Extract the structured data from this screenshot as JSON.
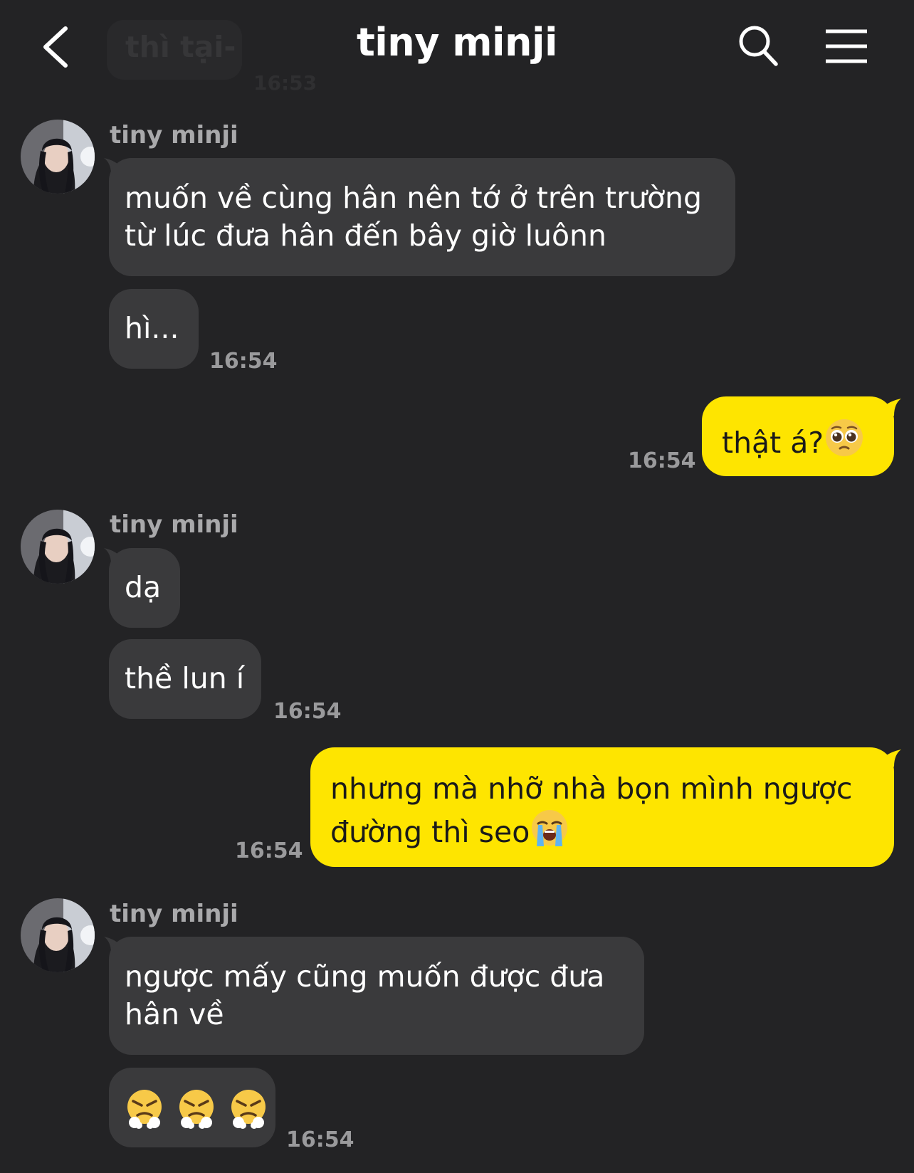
{
  "header": {
    "title": "tiny minji",
    "ghost_text": "thì tại-",
    "ghost_time": "16:53"
  },
  "messages": [
    {
      "sender": "tiny minji",
      "lines": [
        "muốn về cùng hân nên tớ ở trên trường",
        "từ lúc đưa hân đến bây giờ luônn"
      ]
    },
    {
      "text": "hì...",
      "time": "16:54"
    },
    {
      "text": "thật á?",
      "emoji": "pleading-face",
      "time": "16:54",
      "outgoing": true
    },
    {
      "sender": "tiny minji",
      "text": "dạ"
    },
    {
      "text": "thề lun í",
      "time": "16:54"
    },
    {
      "lines": [
        "nhưng mà nhỡ nhà bọn mình ngược",
        "đường thì seo"
      ],
      "emoji": "crying-face",
      "time": "16:54",
      "outgoing": true
    },
    {
      "sender": "tiny minji",
      "lines": [
        "ngược mấy cũng muốn được đưa",
        "hân về"
      ]
    },
    {
      "emoji": "huffing-face x3",
      "time": "16:54"
    }
  ],
  "colors": {
    "background": "#232325",
    "incoming_bubble": "#3a3a3c",
    "outgoing_bubble": "#fee500",
    "timestamp": "#9a9a9c"
  }
}
